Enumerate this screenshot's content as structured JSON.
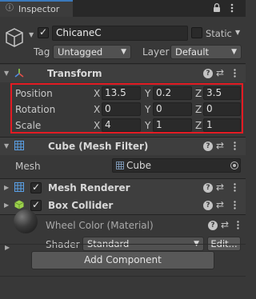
{
  "window": {
    "tab_label": "Inspector",
    "tab_icon": "info-icon"
  },
  "object": {
    "name": "ChicaneC",
    "active": true,
    "static_label": "Static",
    "static_checked": false,
    "tag_label": "Tag",
    "tag_value": "Untagged",
    "layer_label": "Layer",
    "layer_value": "Default"
  },
  "transform": {
    "title": "Transform",
    "rows": [
      {
        "label": "Position",
        "x": "13.5",
        "y": "0.2",
        "z": "3.5"
      },
      {
        "label": "Rotation",
        "x": "0",
        "y": "0",
        "z": "0"
      },
      {
        "label": "Scale",
        "x": "4",
        "y": "1",
        "z": "1"
      }
    ],
    "axis_labels": {
      "x": "X",
      "y": "Y",
      "z": "Z"
    }
  },
  "mesh_filter": {
    "title": "Cube (Mesh Filter)",
    "field_label": "Mesh",
    "field_value": "Cube"
  },
  "mesh_renderer": {
    "title": "Mesh Renderer",
    "enabled": true
  },
  "box_collider": {
    "title": "Box Collider",
    "enabled": true
  },
  "material": {
    "title": "Wheel Color (Material)",
    "shader_label": "Shader",
    "shader_value": "Standard",
    "edit_label": "Edit..."
  },
  "footer": {
    "add_component_label": "Add Component"
  },
  "colors": {
    "background": "#383838",
    "highlight": "#e31b23",
    "tab_accent": "#3a79bb",
    "transform_icon_y": "#8fd14f",
    "transform_icon_x": "#e2504a",
    "transform_icon_z": "#4f8be2",
    "grid_icon": "#5aa0e6",
    "collider_icon": "#9bd14b"
  }
}
